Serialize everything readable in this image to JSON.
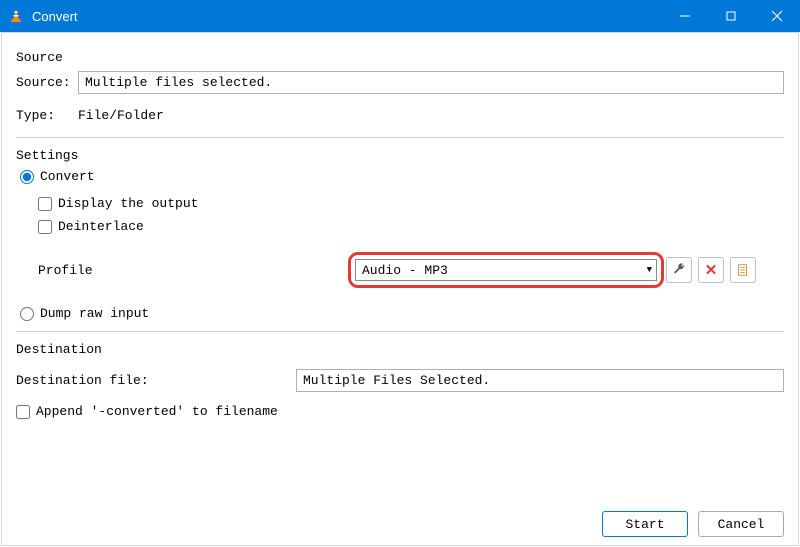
{
  "titlebar": {
    "title": "Convert"
  },
  "source": {
    "section_label": "Source",
    "source_label": "Source:",
    "source_value": "Multiple files selected.",
    "type_label": "Type:",
    "type_value": "File/Folder"
  },
  "settings": {
    "section_label": "Settings",
    "convert_label": "Convert",
    "display_output_label": "Display the output",
    "deinterlace_label": "Deinterlace",
    "profile_label": "Profile",
    "profile_value": "Audio - MP3",
    "dump_raw_label": "Dump raw input"
  },
  "destination": {
    "section_label": "Destination",
    "file_label": "Destination file:",
    "file_value": "Multiple Files Selected.",
    "append_label": "Append '-converted' to filename"
  },
  "buttons": {
    "start": "Start",
    "cancel": "Cancel"
  }
}
